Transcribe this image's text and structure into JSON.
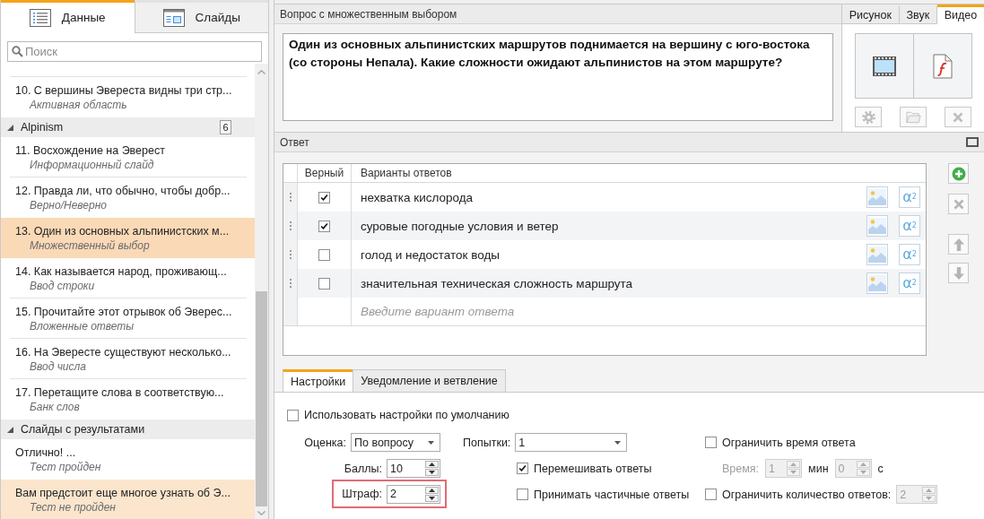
{
  "sidebar": {
    "tabs": [
      {
        "label": "Данные",
        "kind": "data",
        "selected": true
      },
      {
        "label": "Слайды",
        "kind": "slides",
        "selected": false
      }
    ],
    "search": {
      "placeholder": "Поиск"
    },
    "list": [
      {
        "kind": "slide",
        "title": "10. С вершины Эвереста видны три стр...",
        "type": "Активная область",
        "selected": false,
        "hovered": false
      },
      {
        "kind": "group",
        "label": "Alpinism",
        "count": "6",
        "expanded": true,
        "children": [
          {
            "kind": "slide",
            "title": "11. Восхождение на Эверест",
            "type": "Информационный слайд",
            "selected": false,
            "hovered": false
          },
          {
            "kind": "slide",
            "title": "12. Правда ли, что обычно, чтобы добр...",
            "type": "Верно/Неверно",
            "selected": false,
            "hovered": false
          },
          {
            "kind": "slide",
            "title": "13. Один из основных альпинистских м...",
            "type": "Множественный выбор",
            "selected": true,
            "hovered": false
          },
          {
            "kind": "slide",
            "title": "14. Как называется народ, проживающ...",
            "type": "Ввод строки",
            "selected": false,
            "hovered": false
          },
          {
            "kind": "slide",
            "title": "15. Прочитайте этот отрывок об Эверес...",
            "type": "Вложенные ответы",
            "selected": false,
            "hovered": false
          },
          {
            "kind": "slide",
            "title": "16. На Эвересте существуют несколько...",
            "type": "Ввод числа",
            "selected": false,
            "hovered": false
          },
          {
            "kind": "slide",
            "title": "17. Перетащите слова в соответствую...",
            "type": "Банк слов",
            "selected": false,
            "hovered": false
          }
        ]
      },
      {
        "kind": "group",
        "label": "Слайды с результатами",
        "expanded": true,
        "children": [
          {
            "kind": "slide",
            "title": "Отлично! ...",
            "type": "Тест пройден",
            "selected": false,
            "hovered": false
          },
          {
            "kind": "slide",
            "title": "Вам предстоит еще многое узнать об Э...",
            "type": "Тест не пройден",
            "selected": false,
            "hovered": true
          }
        ]
      }
    ]
  },
  "question": {
    "header": "Вопрос с множественным выбором",
    "text": "Один из основных альпинистских маршрутов поднимается на вершину с юго-востока (со стороны Непала). Какие сложности ожидают альпинистов на этом маршруте?"
  },
  "media": {
    "tabs": [
      {
        "label": "Рисунок",
        "selected": false
      },
      {
        "label": "Звук",
        "selected": false
      },
      {
        "label": "Видео",
        "selected": true
      }
    ],
    "actions": [
      {
        "kind": "settings",
        "disabled": true
      },
      {
        "kind": "folder",
        "disabled": true
      },
      {
        "kind": "delete",
        "disabled": true
      }
    ]
  },
  "answer": {
    "header": "Ответ",
    "columns": [
      "Верный",
      "Варианты ответов"
    ],
    "rows": [
      {
        "correct": true,
        "text": "нехватка кислорода",
        "formula_button": "α$^{2}$"
      },
      {
        "correct": true,
        "text": "суровые погодные условия и ветер",
        "formula_button": "α$^{2}$"
      },
      {
        "correct": false,
        "text": "голод и недостаток воды",
        "formula_button": "α$^{2}$"
      },
      {
        "correct": false,
        "text": "значительная техническая сложность маршрута",
        "formula_button": "α$^{2}$"
      }
    ],
    "new_answer": {
      "placeholder": "Введите вариант ответа"
    },
    "tools": [
      {
        "kind": "add",
        "disabled": false
      },
      {
        "kind": "delete",
        "disabled": true
      },
      {
        "kind": "up",
        "disabled": true
      },
      {
        "kind": "down",
        "disabled": true
      }
    ]
  },
  "settings": {
    "tabs": [
      {
        "label": "Настройки",
        "selected": true
      },
      {
        "label": "Уведомление и ветвление",
        "selected": false
      }
    ],
    "use_defaults": {
      "label": "Использовать настройки по умолчанию",
      "checked": false
    },
    "scoring": {
      "label": "Оценка:",
      "value": "По вопросу"
    },
    "points": {
      "label": "Баллы:",
      "value": "10"
    },
    "penalty": {
      "label": "Штраф:",
      "value": "2",
      "highlighted": true
    },
    "attempts": {
      "label": "Попытки:",
      "value": "1"
    },
    "shuffle": {
      "label": "Перемешивать ответы",
      "checked": true
    },
    "partial": {
      "label": "Принимать частичные ответы",
      "checked": false
    },
    "limit_time": {
      "label": "Ограничить время ответа",
      "checked": false
    },
    "time": {
      "label": "Время:",
      "minutes": "1",
      "minutes_unit": "мин",
      "seconds": "0",
      "seconds_unit": "с",
      "disabled": true
    },
    "limit_answers": {
      "label": "Ограничить количество ответов:",
      "checked": false,
      "value": "2",
      "disabled": true
    }
  }
}
